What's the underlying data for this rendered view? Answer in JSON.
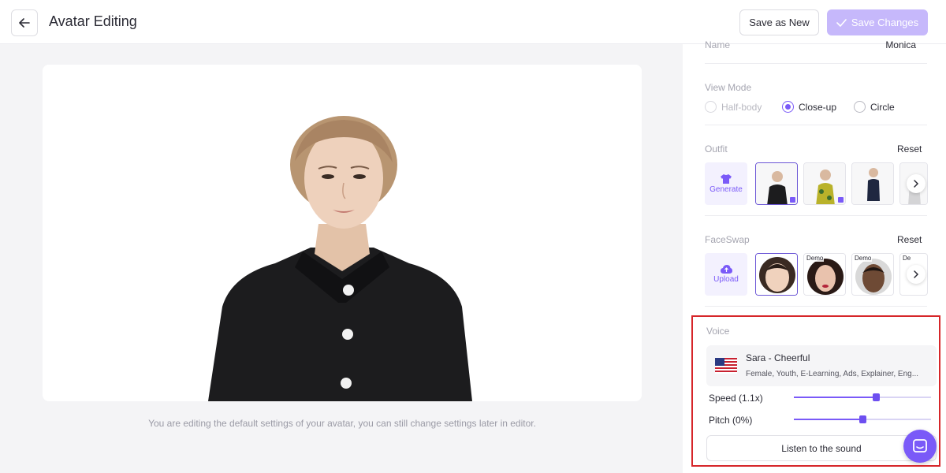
{
  "header": {
    "title": "Avatar Editing",
    "save_new_label": "Save as New",
    "save_changes_label": "Save Changes"
  },
  "canvas": {
    "note": "You are editing the default settings of your avatar, you can still change settings later in editor."
  },
  "panel": {
    "name_label": "Name",
    "name_value": "Monica",
    "view_mode": {
      "label": "View Mode",
      "options": [
        "Half-body",
        "Close-up",
        "Circle"
      ],
      "selected": "Close-up"
    },
    "outfit": {
      "label": "Outfit",
      "reset_label": "Reset",
      "generate_label": "Generate"
    },
    "faceswap": {
      "label": "FaceSwap",
      "reset_label": "Reset",
      "upload_label": "Upload",
      "demo_tag": "Demo",
      "partial_tag": "De"
    },
    "voice": {
      "label": "Voice",
      "name": "Sara - Cheerful",
      "description": "Female, Youth, E-Learning, Ads, Explainer, Eng...",
      "speed_label": "Speed (1.1x)",
      "speed_fraction": 0.6,
      "pitch_label": "Pitch (0%)",
      "pitch_fraction": 0.5,
      "listen_label": "Listen to the sound"
    }
  },
  "colors": {
    "accent": "#7a5af8",
    "accent_light": "#c6b8fb",
    "highlight": "#d6262a"
  }
}
